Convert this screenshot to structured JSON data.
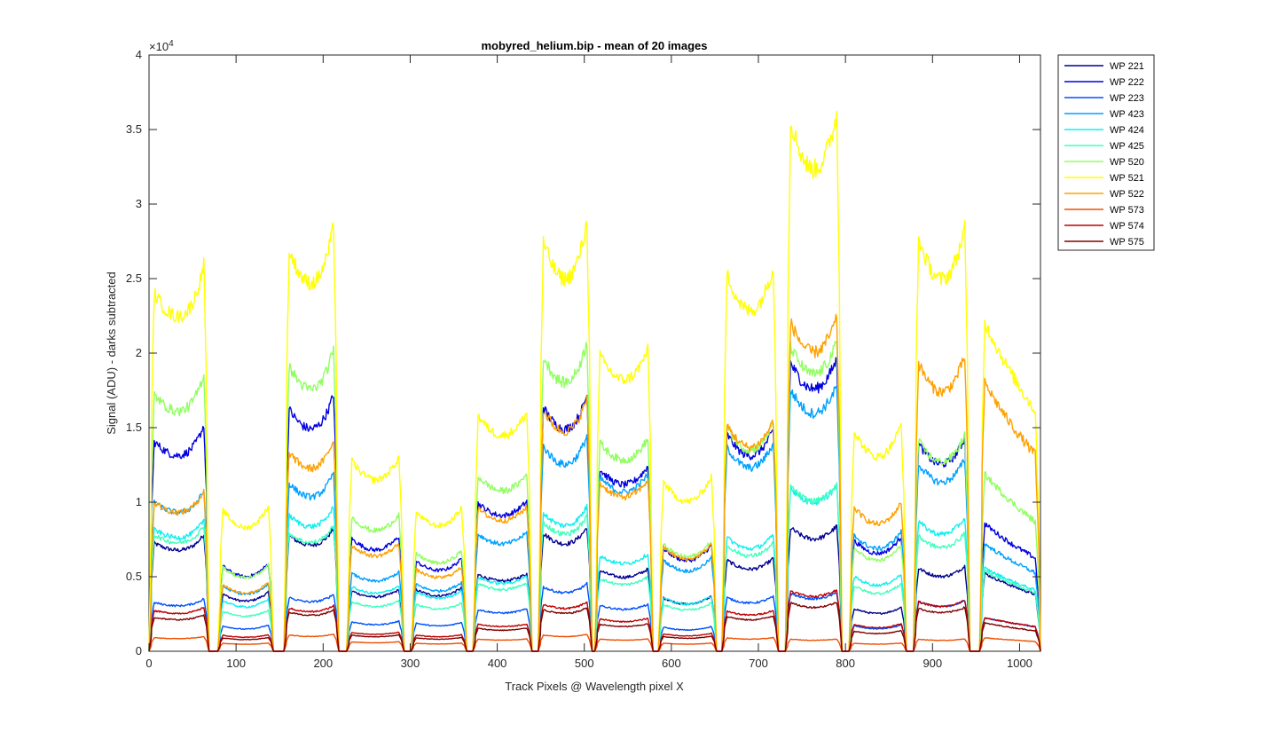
{
  "chart_data": {
    "type": "line",
    "title": "mobyred_helium.bip - mean of 20 images",
    "xlabel": "Track Pixels @ Wavelength pixel X",
    "ylabel": "Signal (ADU) - darks subtracted",
    "xlim": [
      0,
      1024
    ],
    "ylim": [
      0,
      40000
    ],
    "y_exponent_label": "×10",
    "y_exponent_power": "4",
    "xticks": [
      0,
      100,
      200,
      300,
      400,
      500,
      600,
      700,
      800,
      900,
      1000
    ],
    "xtick_labels": [
      "0",
      "100",
      "200",
      "300",
      "400",
      "500",
      "600",
      "700",
      "800",
      "900",
      "1000"
    ],
    "yticks": [
      0,
      5000,
      10000,
      15000,
      20000,
      25000,
      30000,
      35000,
      40000
    ],
    "ytick_labels": [
      "0",
      "0.5",
      "1",
      "1.5",
      "2",
      "2.5",
      "3",
      "3.5",
      "4"
    ],
    "grid": false,
    "legend_position": "outside-top-right",
    "fiber_blocks": [
      {
        "start": 2,
        "end": 67,
        "dip": 0.08,
        "edge_rise": 0.12
      },
      {
        "start": 81,
        "end": 141,
        "dip": 0.15,
        "edge_rise": 0.05
      },
      {
        "start": 157,
        "end": 216,
        "dip": 0.1,
        "edge_rise": 0.1
      },
      {
        "start": 229,
        "end": 291,
        "dip": 0.12,
        "edge_rise": 0.03
      },
      {
        "start": 303,
        "end": 363,
        "dip": 0.12,
        "edge_rise": 0.05
      },
      {
        "start": 374,
        "end": 438,
        "dip": 0.1,
        "edge_rise": 0.02
      },
      {
        "start": 449,
        "end": 507,
        "dip": 0.11,
        "edge_rise": 0.08
      },
      {
        "start": 514,
        "end": 577,
        "dip": 0.1,
        "edge_rise": 0.03
      },
      {
        "start": 587,
        "end": 650,
        "dip": 0.14,
        "edge_rise": 0.05
      },
      {
        "start": 660,
        "end": 721,
        "dip": 0.12,
        "edge_rise": 0.03
      },
      {
        "start": 733,
        "end": 794,
        "dip": 0.11,
        "edge_rise": 0.02
      },
      {
        "start": 806,
        "end": 868,
        "dip": 0.14,
        "edge_rise": 0.05
      },
      {
        "start": 880,
        "end": 941,
        "dip": 0.12,
        "edge_rise": 0.04
      },
      {
        "start": 956,
        "end": 1022,
        "dip": 0.02,
        "edge_rise": 0.0,
        "slope": -0.3
      }
    ],
    "series": [
      {
        "name": "WP 221",
        "color": "#00008F",
        "peaks": [
          8000,
          4300,
          8600,
          4500,
          4600,
          5700,
          8800,
          6000,
          4000,
          6800,
          9200,
          3200,
          6200,
          5800
        ]
      },
      {
        "name": "WP 222",
        "color": "#0000DF",
        "peaks": [
          15500,
          6400,
          18000,
          8400,
          6700,
          11000,
          18200,
          13500,
          7700,
          16200,
          21500,
          8300,
          15500,
          9500
        ]
      },
      {
        "name": "WP 223",
        "color": "#0050FF",
        "peaks": [
          3600,
          1900,
          4000,
          2200,
          2100,
          3100,
          4800,
          3400,
          1800,
          4000,
          4300,
          1900,
          3700,
          2500
        ]
      },
      {
        "name": "WP 423",
        "color": "#00A0FF",
        "peaks": [
          11000,
          4900,
          12500,
          5800,
          5000,
          8700,
          15300,
          12900,
          6800,
          15200,
          19500,
          8700,
          14000,
          8000
        ]
      },
      {
        "name": "WP 424",
        "color": "#10EFEF",
        "peaks": [
          9000,
          3800,
          10100,
          4800,
          4400,
          5500,
          10300,
          7100,
          4000,
          8500,
          12200,
          5600,
          9700,
          6200
        ]
      },
      {
        "name": "WP 425",
        "color": "#40FFBF",
        "peaks": [
          8600,
          3000,
          8800,
          3700,
          3500,
          5000,
          9600,
          5400,
          3500,
          7900,
          12300,
          4900,
          8600,
          6000
        ]
      },
      {
        "name": "WP 520",
        "color": "#90FF60",
        "peaks": [
          19000,
          6300,
          21200,
          10000,
          7300,
          13000,
          22000,
          15500,
          8000,
          16700,
          22700,
          7700,
          15700,
          13200
        ]
      },
      {
        "name": "WP 521",
        "color": "#FFFF00",
        "peaks": [
          26500,
          10600,
          29800,
          14200,
          10400,
          17500,
          30500,
          22000,
          12700,
          28200,
          39500,
          16500,
          30800,
          24500
        ]
      },
      {
        "name": "WP 522",
        "color": "#FFA000",
        "peaks": [
          11000,
          5000,
          14800,
          7900,
          6100,
          10600,
          18000,
          12500,
          7800,
          16900,
          24500,
          10800,
          21500,
          20000
        ]
      },
      {
        "name": "WP 573",
        "color": "#EF4F00",
        "peaks": [
          1000,
          600,
          1200,
          700,
          600,
          900,
          1200,
          900,
          600,
          1000,
          900,
          600,
          900,
          1000
        ]
      },
      {
        "name": "WP 574",
        "color": "#BF0000",
        "peaks": [
          3000,
          1200,
          3200,
          1400,
          1200,
          2000,
          3500,
          2400,
          1300,
          3000,
          4500,
          2000,
          3700,
          2500
        ]
      },
      {
        "name": "WP 575",
        "color": "#800000",
        "peaks": [
          2500,
          1000,
          2900,
          1200,
          1000,
          1700,
          3100,
          2000,
          1100,
          2600,
          3600,
          1500,
          3200,
          2100
        ]
      }
    ]
  }
}
